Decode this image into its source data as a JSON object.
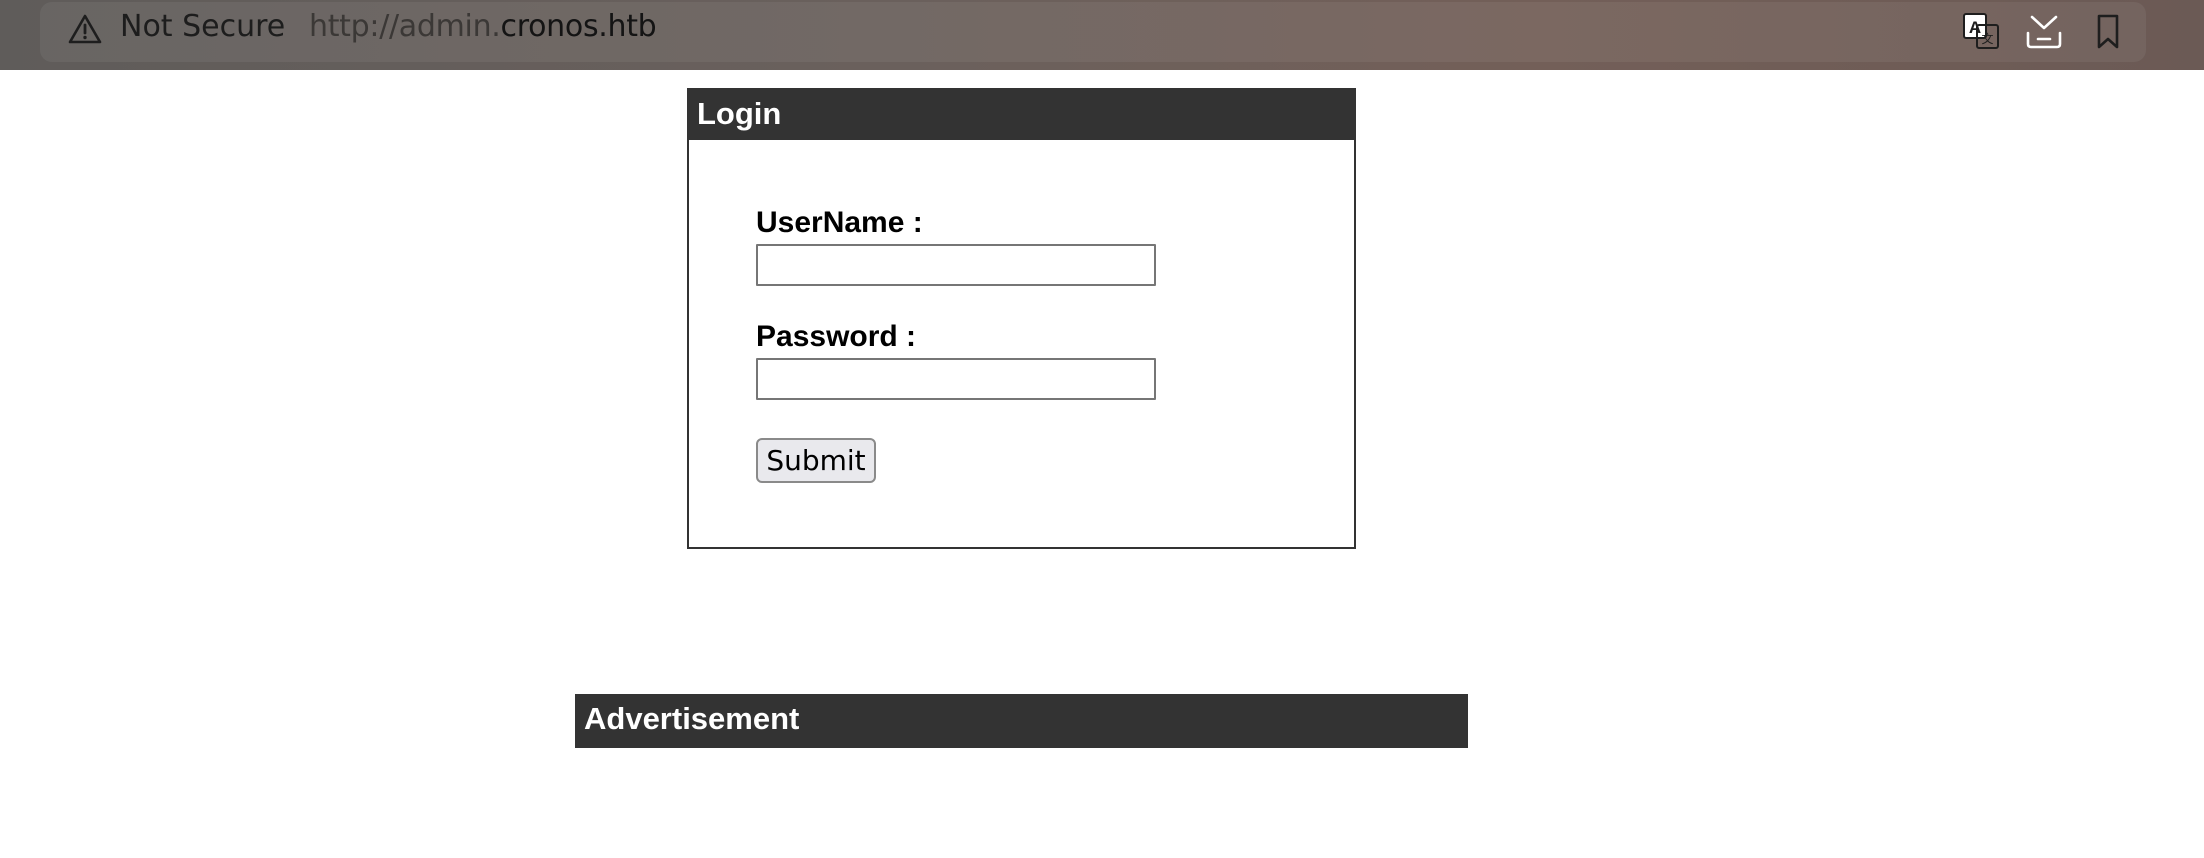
{
  "browser": {
    "security_label": "Not Secure",
    "url_scheme_prefix": "http://admin.",
    "url_host": "cronos.htb",
    "icons": [
      "warning-icon",
      "translate-icon",
      "download-icon",
      "bookmark-icon"
    ]
  },
  "login": {
    "title": "Login",
    "username_label": "UserName :",
    "username_value": "",
    "password_label": "Password :",
    "password_value": "",
    "submit_label": "Submit"
  },
  "advertisement": {
    "title": "Advertisement"
  },
  "colors": {
    "panel_header_bg": "#333333",
    "panel_header_text": "#ffffff",
    "panel_border": "#333333"
  }
}
